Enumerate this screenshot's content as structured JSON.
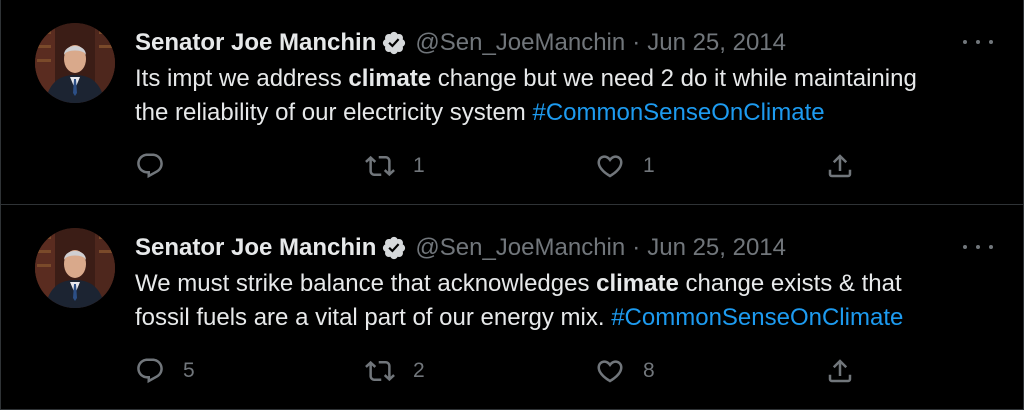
{
  "tweets": [
    {
      "author_name": "Senator Joe Manchin",
      "handle": "@Sen_JoeManchin",
      "separator": "·",
      "date": "Jun 25, 2014",
      "text_before": "Its impt we address ",
      "text_bold": "climate",
      "text_after": " change but we need 2 do it while maintaining\nthe reliability of our electricity system ",
      "hashtag": "#CommonSenseOnClimate",
      "reply_count": "",
      "retweet_count": "1",
      "like_count": "1"
    },
    {
      "author_name": "Senator Joe Manchin",
      "handle": "@Sen_JoeManchin",
      "separator": "·",
      "date": "Jun 25, 2014",
      "text_before": "We must strike balance that acknowledges ",
      "text_bold": "climate",
      "text_after": " change exists & that\nfossil fuels are a vital part of our energy mix. ",
      "hashtag": "#CommonSenseOnClimate",
      "reply_count": "5",
      "retweet_count": "2",
      "like_count": "8"
    }
  ],
  "colors": {
    "background": "#000000",
    "primary_text": "#e7e9ea",
    "secondary_text": "#71767b",
    "link": "#1d9bf0",
    "divider": "#2f3336"
  },
  "icons": {
    "verified": "verified-badge-icon",
    "more": "more-dots-icon",
    "reply": "reply-icon",
    "retweet": "retweet-icon",
    "like": "heart-icon",
    "share": "share-icon"
  }
}
